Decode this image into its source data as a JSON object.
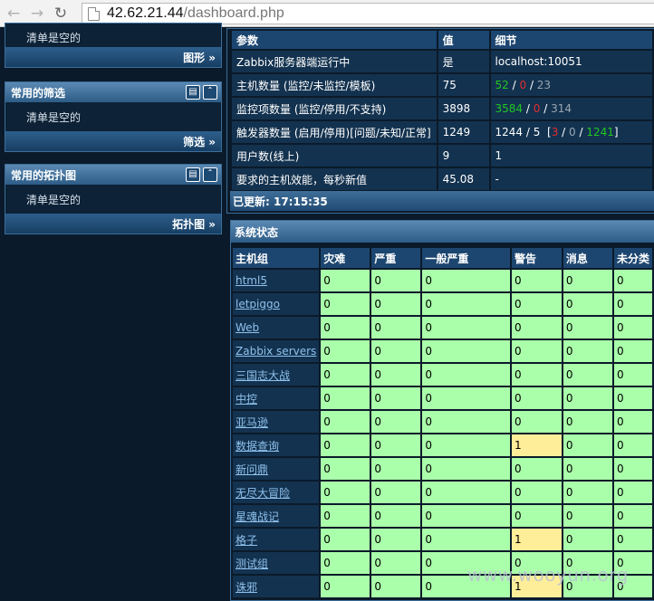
{
  "browser": {
    "url_host": "42.62.21.44",
    "url_path": "/dashboard.php"
  },
  "sidebar": {
    "widgets": [
      {
        "title": "",
        "body": "清单是空的",
        "footer_link": "图形 »"
      },
      {
        "title": "常用的筛选",
        "body": "清单是空的",
        "footer_link": "筛选 »"
      },
      {
        "title": "常用的拓扑图",
        "body": "清单是空的",
        "footer_link": "拓扑图 »"
      }
    ]
  },
  "server_info": {
    "headers": [
      "参数",
      "值",
      "细节"
    ],
    "rows": [
      {
        "param": "Zabbix服务器端运行中",
        "value": "是",
        "detail": "localhost:10051"
      },
      {
        "param": "主机数量 (监控/未监控/模板)",
        "value": "75",
        "detail_parts": [
          "52",
          " / ",
          "0",
          " / ",
          "23"
        ]
      },
      {
        "param": "监控项数量 (监控/停用/不支持)",
        "value": "3898",
        "detail_parts": [
          "3584",
          " / ",
          "0",
          " / ",
          "314"
        ]
      },
      {
        "param": "触发器数量 (启用/停用)[问题/未知/正常]",
        "value": "1249",
        "detail_parts": [
          "1244 / 5  [",
          "3",
          " / ",
          "0",
          " / ",
          "1241",
          "]"
        ]
      },
      {
        "param": "用户数(线上)",
        "value": "9",
        "detail": "1"
      },
      {
        "param": "要求的主机效能，每秒新值",
        "value": "45.08",
        "detail": "-"
      }
    ],
    "updated": "已更新: 17:15:35"
  },
  "system_status": {
    "title": "系统状态",
    "headers": [
      "主机组",
      "灾难",
      "严重",
      "一般严重",
      "警告",
      "消息",
      "未分类"
    ],
    "rows": [
      {
        "group": "html5",
        "values": [
          "0",
          "0",
          "0",
          "0",
          "0",
          "0"
        ]
      },
      {
        "group": "letpiggo",
        "values": [
          "0",
          "0",
          "0",
          "0",
          "0",
          "0"
        ]
      },
      {
        "group": "Web",
        "values": [
          "0",
          "0",
          "0",
          "0",
          "0",
          "0"
        ]
      },
      {
        "group": "Zabbix servers",
        "values": [
          "0",
          "0",
          "0",
          "0",
          "0",
          "0"
        ]
      },
      {
        "group": "三国志大战",
        "values": [
          "0",
          "0",
          "0",
          "0",
          "0",
          "0"
        ]
      },
      {
        "group": "中控",
        "values": [
          "0",
          "0",
          "0",
          "0",
          "0",
          "0"
        ]
      },
      {
        "group": "亚马逊",
        "values": [
          "0",
          "0",
          "0",
          "0",
          "0",
          "0"
        ]
      },
      {
        "group": "数据查询",
        "values": [
          "0",
          "0",
          "0",
          "1",
          "0",
          "0"
        ]
      },
      {
        "group": "新问鼎",
        "values": [
          "0",
          "0",
          "0",
          "0",
          "0",
          "0"
        ]
      },
      {
        "group": "无尽大冒险",
        "values": [
          "0",
          "0",
          "0",
          "0",
          "0",
          "0"
        ]
      },
      {
        "group": "星魂战记",
        "values": [
          "0",
          "0",
          "0",
          "0",
          "0",
          "0"
        ]
      },
      {
        "group": "格子",
        "values": [
          "0",
          "0",
          "0",
          "1",
          "0",
          "0"
        ]
      },
      {
        "group": "测试组",
        "values": [
          "0",
          "0",
          "0",
          "0",
          "0",
          "0"
        ]
      },
      {
        "group": "诛邪",
        "values": [
          "0",
          "0",
          "0",
          "1",
          "0",
          "0"
        ]
      }
    ]
  },
  "watermark": "www.wooyun.org",
  "colors": {
    "ok_cell": "#aaffaa",
    "warning_cell": "#ffee99",
    "header_blue": "#2d5c86"
  }
}
